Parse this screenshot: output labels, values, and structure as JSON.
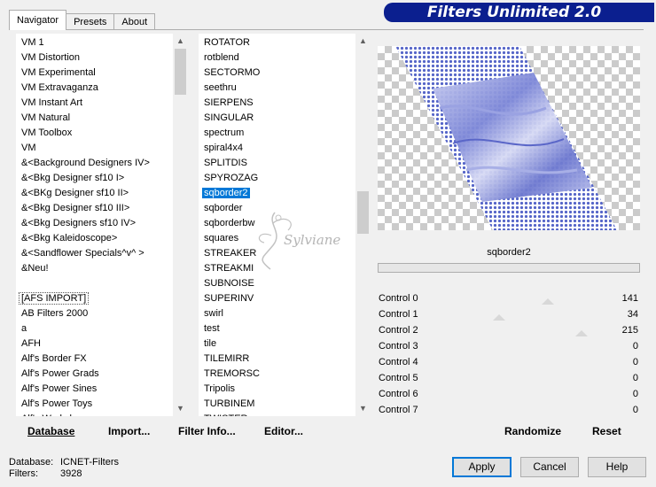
{
  "header": {
    "title": "Filters Unlimited 2.0"
  },
  "tabs": [
    {
      "label": "Navigator",
      "active": true
    },
    {
      "label": "Presets",
      "active": false
    },
    {
      "label": "About",
      "active": false
    }
  ],
  "categories": {
    "items": [
      "VM 1",
      "VM Distortion",
      "VM Experimental",
      "VM Extravaganza",
      "VM Instant Art",
      "VM Natural",
      "VM Toolbox",
      "VM",
      "&<Background Designers IV>",
      "&<Bkg Designer sf10 I>",
      "&<BKg Designer sf10 II>",
      "&<Bkg Designer sf10 III>",
      "&<Bkg Designers sf10 IV>",
      "&<Bkg Kaleidoscope>",
      "&<Sandflower Specials^v^ >",
      "&Neu!",
      "",
      "[AFS IMPORT]",
      "AB Filters 2000",
      "a",
      "AFH",
      "Alf's Border FX",
      "Alf's Power Grads",
      "Alf's Power Sines",
      "Alf's Power Toys",
      "Alf's Worksho..."
    ],
    "focused_index": 17
  },
  "filters": {
    "items": [
      "ROTATOR",
      "rotblend",
      "SECTORMO",
      "seethru",
      "SIERPENS",
      "SINGULAR",
      "spectrum",
      "spiral4x4",
      "SPLITDIS",
      "SPYROZAG",
      "sqborder2",
      "sqborder",
      "sqborderbw",
      "squares",
      "STREAKER",
      "STREAKMI",
      "SUBNOISE",
      "SUPERINV",
      "swirl",
      "test",
      "tile",
      "TILEMIRR",
      "TREMORSC",
      "Tripolis",
      "TURBINEM",
      "TWISTER..."
    ],
    "selected_index": 10
  },
  "left_buttons": {
    "database": "Database",
    "import": "Import...",
    "filter_info": "Filter Info...",
    "editor": "Editor..."
  },
  "preview": {
    "filter_name": "sqborder2",
    "progress": 0
  },
  "controls": [
    {
      "label": "Control 0",
      "value": "141",
      "fraction": 0.553
    },
    {
      "label": "Control 1",
      "value": "34",
      "fraction": 0.133
    },
    {
      "label": "Control 2",
      "value": "215",
      "fraction": 0.843
    },
    {
      "label": "Control 3",
      "value": "0",
      "fraction": 0
    },
    {
      "label": "Control 4",
      "value": "0",
      "fraction": 0
    },
    {
      "label": "Control 5",
      "value": "0",
      "fraction": 0
    },
    {
      "label": "Control 6",
      "value": "0",
      "fraction": 0
    },
    {
      "label": "Control 7",
      "value": "0",
      "fraction": 0
    }
  ],
  "right_buttons": {
    "randomize": "Randomize",
    "reset": "Reset"
  },
  "status": {
    "database_label": "Database:",
    "database_value": "ICNET-Filters",
    "filters_label": "Filters:",
    "filters_value": "3928"
  },
  "dialog_buttons": {
    "apply": "Apply",
    "cancel": "Cancel",
    "help": "Help"
  },
  "watermark": "Sylviane",
  "colors": {
    "banner": "#0b1f8f",
    "selection": "#0078d7",
    "pattern": "#5565c8"
  }
}
